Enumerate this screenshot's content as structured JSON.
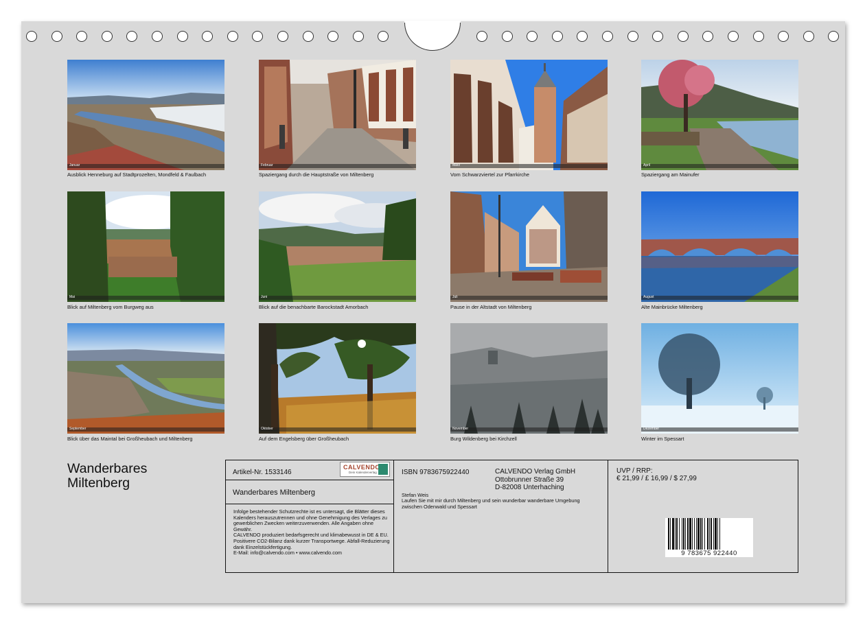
{
  "months": [
    {
      "label": "Januar",
      "caption": "Ausblick Henneburg auf Stadtprozelten, Mondfeld & Faulbach"
    },
    {
      "label": "Februar",
      "caption": "Spaziergang durch die Hauptstraße von Miltenberg"
    },
    {
      "label": "März",
      "caption": "Vom Schwarzviertel zur Pfarrkirche"
    },
    {
      "label": "April",
      "caption": "Spaziergang am Mainufer"
    },
    {
      "label": "Mai",
      "caption": "Blick auf Miltenberg vom Burgweg aus"
    },
    {
      "label": "Juni",
      "caption": "Blick auf die benachbarte Barockstadt Amorbach"
    },
    {
      "label": "Juli",
      "caption": "Pause in der Altstadt von Miltenberg"
    },
    {
      "label": "August",
      "caption": "Alte Mainbrücke Miltenberg"
    },
    {
      "label": "September",
      "caption": "Blick über das Maintal bei Großheubach und Miltenberg"
    },
    {
      "label": "Oktober",
      "caption": "Auf dem Engelsberg über Großheubach"
    },
    {
      "label": "November",
      "caption": "Burg Wildenberg bei Kirchzell"
    },
    {
      "label": "Dezember",
      "caption": "Winter im Spessart"
    }
  ],
  "title_line1": "Wanderbares",
  "title_line2": "Miltenberg",
  "info": {
    "article_no": "Artikel-Nr. 1533146",
    "logo_text": "CALVENDO",
    "logo_sub": "Dein Kalenderverlag",
    "calendar_name": "Wanderbares Miltenberg",
    "legal": "Infolge bestehender Schutzrechte ist es untersagt, die Blätter dieses Kalenders herauszutrennen und ohne Genehmigung des Verlages zu gewerblichen Zwecken weiterzuverwenden. Alle Angaben ohne Gewähr.\n CALVENDO produziert bedarfsgerecht und klimabewusst in DE & EU. Positivere CO2-Bilanz dank kurzer Transportwege. Abfall-Reduzierung dank Einzelstückfertigung.\n E-Mail: info@calvendo.com • www.calvendo.com",
    "isbn": "ISBN 9783675922440",
    "publisher_line1": "CALVENDO Verlag GmbH",
    "publisher_line2": "Ottobrunner Straße 39",
    "publisher_line3": "D-82008 Unterhaching",
    "author": "Stefan Weis",
    "description": "Laufen Sie mit mir durch Miltenberg und sein wunderbar wanderbare Umgebung zwischen Odenwald und Spessart",
    "price_label": "UVP / RRP:",
    "price": "€ 21,99 / £ 16,99 / $ 27,99",
    "barcode_text": "9 783675 922440"
  },
  "colors": {
    "sheet": "#d9d9d9",
    "border": "#111111",
    "logo_red": "#a4432c",
    "logo_green": "#2d8a6f"
  }
}
